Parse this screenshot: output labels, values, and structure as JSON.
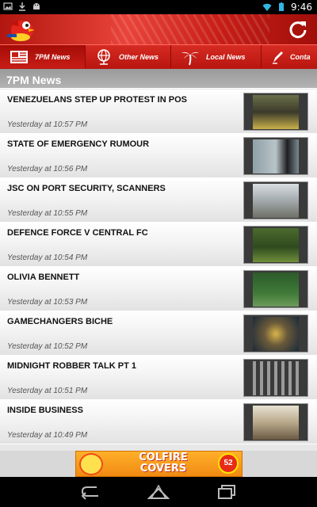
{
  "status_bar": {
    "time": "9:46",
    "icons": [
      "image-icon",
      "download-icon",
      "android-icon",
      "wifi-icon",
      "battery-icon"
    ]
  },
  "header": {
    "logo": "tv6-logo",
    "refresh_icon": "refresh-icon"
  },
  "tabs": [
    {
      "label": "7PM News",
      "icon": "newspaper-icon",
      "active": true
    },
    {
      "label": "Other News",
      "icon": "globe-icon",
      "active": false
    },
    {
      "label": "Local News",
      "icon": "palm-tree-icon",
      "active": false
    },
    {
      "label": "Conta",
      "icon": "pen-icon",
      "active": false
    }
  ],
  "section": {
    "title": "7PM News"
  },
  "news_items": [
    {
      "title": "VENEZUELANS STEP UP PROTEST IN POS",
      "time": "Yesterday at 10:57 PM"
    },
    {
      "title": "STATE OF EMERGENCY RUMOUR",
      "time": "Yesterday at 10:56 PM"
    },
    {
      "title": " JSC ON PORT SECURITY, SCANNERS",
      "time": "Yesterday at 10:55 PM"
    },
    {
      "title": "DEFENCE FORCE V CENTRAL FC",
      "time": "Yesterday at 10:54 PM"
    },
    {
      "title": " OLIVIA BENNETT",
      "time": "Yesterday at 10:53 PM"
    },
    {
      "title": " GAMECHANGERS BICHE",
      "time": "Yesterday at 10:52 PM"
    },
    {
      "title": "MIDNIGHT ROBBER TALK PT 1",
      "time": "Yesterday at 10:51 PM"
    },
    {
      "title": " INSIDE BUSINESS",
      "time": "Yesterday at 10:49 PM"
    }
  ],
  "ad": {
    "text_line1": "COLFIRE",
    "text_line2": "COVERS",
    "badge": "52"
  },
  "nav": {
    "back_icon": "back-icon",
    "home_icon": "home-icon",
    "recents_icon": "recents-icon"
  },
  "colors": {
    "brand_red": "#c61d16",
    "section_gray": "#a6a6a6"
  }
}
